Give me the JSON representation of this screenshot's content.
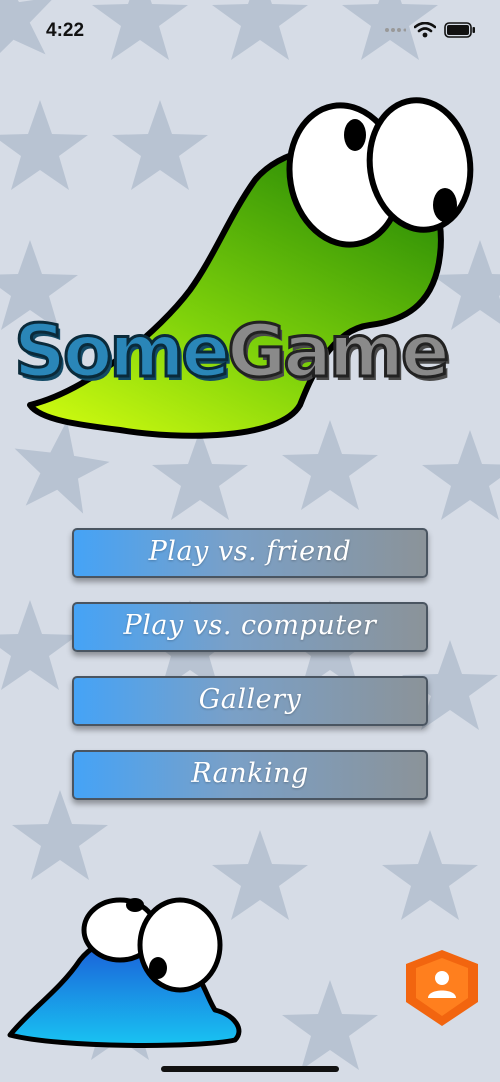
{
  "status_bar": {
    "time": "4:22"
  },
  "logo": {
    "part1": "Some",
    "part2": "Game",
    "part1_color": "#2a86b8",
    "part2_color": "#8a8a8a"
  },
  "menu": {
    "play_friend": "Play vs. friend",
    "play_computer": "Play vs. computer",
    "gallery": "Gallery",
    "ranking": "Ranking"
  },
  "colors": {
    "background": "#d6dce6",
    "star": "#b8c3d2",
    "button_left": "#45a3f6",
    "button_right": "#8b9399",
    "badge": "#f2650f"
  },
  "icons": [
    "wifi-icon",
    "battery-icon",
    "signal-icon",
    "profile-icon"
  ]
}
